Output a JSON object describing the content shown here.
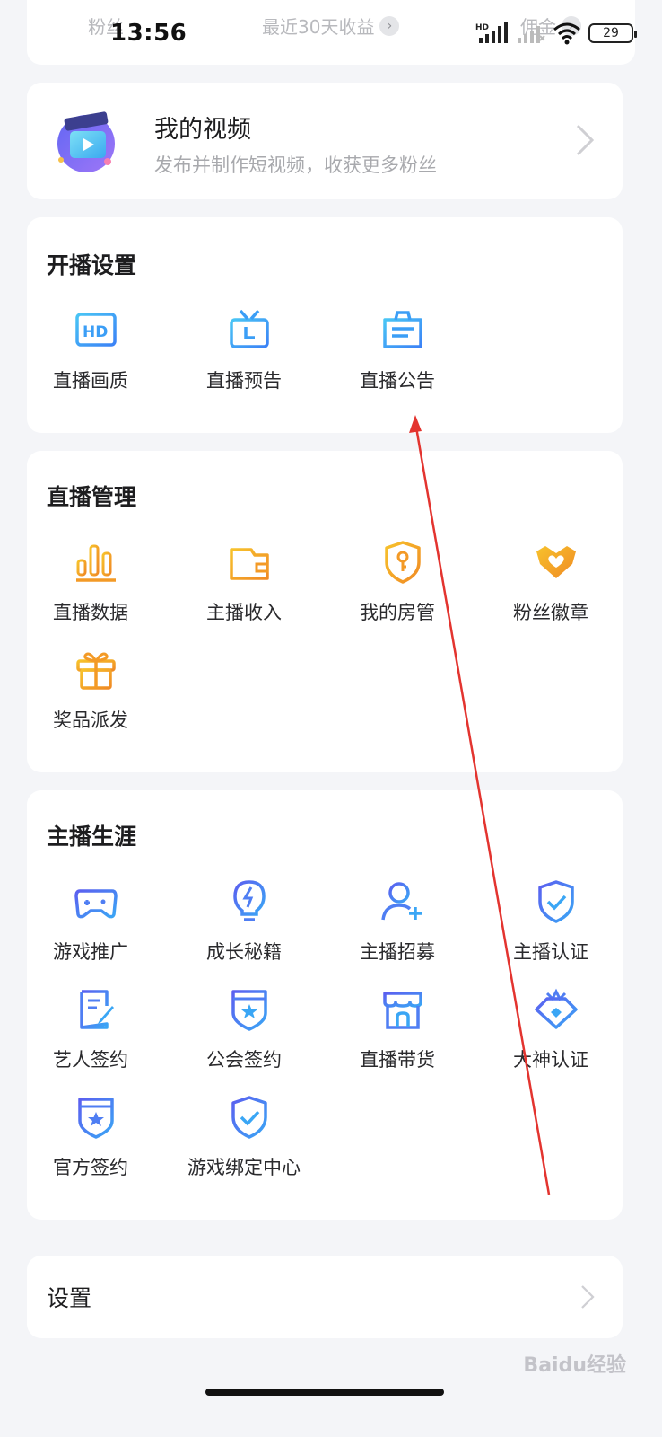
{
  "status_bar": {
    "time": "13:56",
    "battery": "29",
    "network": "HD"
  },
  "top_stats": {
    "fans": "粉丝",
    "income": "最近30天收益",
    "commission": "佣金"
  },
  "video_card": {
    "title": "我的视频",
    "subtitle": "发布并制作短视频，收获更多粉丝"
  },
  "sections": {
    "broadcast_settings": {
      "title": "开播设置",
      "items": [
        {
          "label": "直播画质",
          "icon": "hd-icon"
        },
        {
          "label": "直播预告",
          "icon": "tv-icon"
        },
        {
          "label": "直播公告",
          "icon": "notice-icon"
        }
      ]
    },
    "live_management": {
      "title": "直播管理",
      "items": [
        {
          "label": "直播数据",
          "icon": "bar-chart-icon"
        },
        {
          "label": "主播收入",
          "icon": "wallet-icon"
        },
        {
          "label": "我的房管",
          "icon": "shield-key-icon"
        },
        {
          "label": "粉丝徽章",
          "icon": "heart-badge-icon"
        },
        {
          "label": "奖品派发",
          "icon": "gift-icon"
        }
      ]
    },
    "anchor_career": {
      "title": "主播生涯",
      "items": [
        {
          "label": "游戏推广",
          "icon": "gamepad-icon"
        },
        {
          "label": "成长秘籍",
          "icon": "lightbulb-icon"
        },
        {
          "label": "主播招募",
          "icon": "add-user-icon"
        },
        {
          "label": "主播认证",
          "icon": "shield-check-icon"
        },
        {
          "label": "艺人签约",
          "icon": "doc-pen-icon"
        },
        {
          "label": "公会签约",
          "icon": "shield-star-icon"
        },
        {
          "label": "直播带货",
          "icon": "store-icon"
        },
        {
          "label": "大神认证",
          "icon": "crown-gem-icon"
        },
        {
          "label": "官方签约",
          "icon": "badge-star-icon"
        },
        {
          "label": "游戏绑定中心",
          "icon": "shield-check-icon"
        }
      ]
    }
  },
  "settings": {
    "label": "设置"
  },
  "watermark": "Baidu经验",
  "colors": {
    "blue_accent": "#3b82f6",
    "orange_accent": "#f5a623",
    "annotation_arrow": "#e3342f"
  }
}
